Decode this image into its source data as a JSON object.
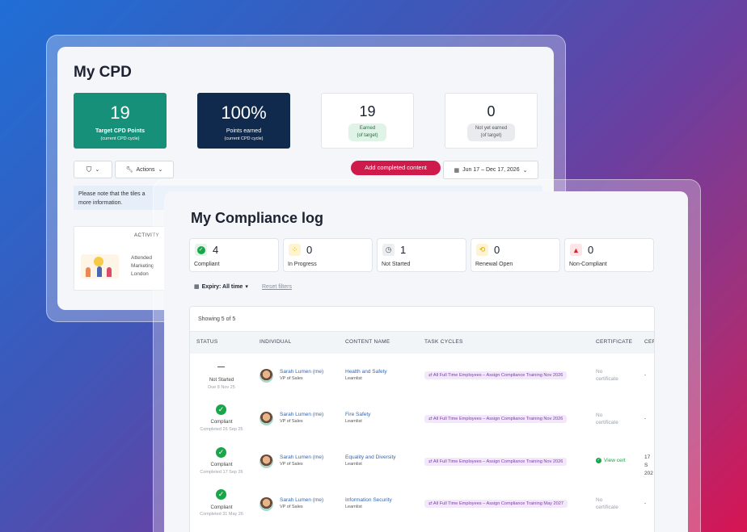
{
  "cpd": {
    "title": "My CPD",
    "tiles": [
      {
        "value": "19",
        "label": "Target CPD Points",
        "sub": "(current CPD cycle)"
      },
      {
        "value": "100%",
        "label": "Points earned",
        "sub": "(current CPD cycle)"
      },
      {
        "value": "19",
        "pill_line1": "Earned",
        "pill_line2": "(of target)"
      },
      {
        "value": "0",
        "pill_line1": "Not yet earned",
        "pill_line2": "(of target)"
      }
    ],
    "actions_label": "Actions",
    "add_button": "Add completed content",
    "date_range": "Jun 17 – Dec 17, 2026",
    "notice": "Please note that the tiles a",
    "notice2": "more information.",
    "activity_header": "ACTIVITY",
    "activity_text": [
      "Attended",
      "Marketing",
      "London"
    ]
  },
  "compliance": {
    "title": "My Compliance log",
    "stats": [
      {
        "count": "4",
        "label": "Compliant",
        "icon": "check-circle-icon",
        "color": "#19a64a",
        "bg": "#e3f5e9"
      },
      {
        "count": "0",
        "label": "In Progress",
        "icon": "spinner-icon",
        "color": "#d9a400",
        "bg": "#fff4d1"
      },
      {
        "count": "1",
        "label": "Not Started",
        "icon": "clock-icon",
        "color": "#555",
        "bg": "#eceef1"
      },
      {
        "count": "0",
        "label": "Renewal Open",
        "icon": "renew-icon",
        "color": "#d9a400",
        "bg": "#fff4d1"
      },
      {
        "count": "0",
        "label": "Non-Compliant",
        "icon": "warning-icon",
        "color": "#d0283a",
        "bg": "#fde4e6"
      }
    ],
    "expiry_label": "Expiry: All time",
    "reset_filters": "Reset filters",
    "showing": "Showing 5 of 5",
    "columns": [
      "STATUS",
      "INDIVIDUAL",
      "CONTENT NAME",
      "TASK CYCLES",
      "CERTIFICATE",
      "CER"
    ],
    "rows": [
      {
        "status": "Not Started",
        "status_date": "Due 8 Nov 25",
        "name": "Sarah Lumen (me)",
        "role": "VP of Sales",
        "content": "Health and Safety",
        "provider": "Learnlist",
        "cycle": "⇄ All Full Time Employees – Assign Compliance Training Nov 2026",
        "cert1": "No",
        "cert2": "certificate",
        "extra": "-"
      },
      {
        "status": "Compliant",
        "status_date": "Completed 26 Sep 25",
        "name": "Sarah Lumen (me)",
        "role": "VP of Sales",
        "content": "Fire Safety",
        "provider": "Learnlist",
        "cycle": "⇄ All Full Time Employees – Assign Compliance Training Nov 2026",
        "cert1": "No",
        "cert2": "certificate",
        "extra": "-"
      },
      {
        "status": "Compliant",
        "status_date": "Completed 17 Sep 26",
        "name": "Sarah Lumen (me)",
        "role": "VP of Sales",
        "content": "Equality and Diversity",
        "provider": "Learnlist",
        "cycle": "⇄ All Full Time Employees – Assign Compliance Training Nov 2026",
        "cert1": "View cert",
        "cert2": "",
        "extra": "17 S",
        "extra2": "202"
      },
      {
        "status": "Compliant",
        "status_date": "Completed 31 May 26",
        "name": "Sarah Lumen (me)",
        "role": "VP of Sales",
        "content": "Information Security",
        "provider": "Learnlist",
        "cycle": "⇄ All Full Time Employees – Assign Compliance Training May 2027",
        "cert1": "No",
        "cert2": "certificate",
        "extra": "-"
      }
    ]
  }
}
